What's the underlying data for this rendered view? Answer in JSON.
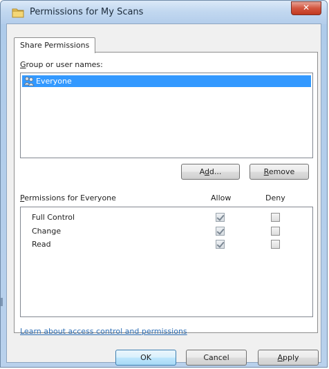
{
  "window": {
    "title": "Permissions for My Scans",
    "close_label": "✕"
  },
  "tab": {
    "label": "Share Permissions"
  },
  "groups": {
    "label_prefix": "G",
    "label_rest": "roup or user names:",
    "items": [
      {
        "name": "Everyone",
        "selected": true
      }
    ]
  },
  "buttons": {
    "add_pre": "A",
    "add_u": "d",
    "add_post": "d...",
    "remove_u": "R",
    "remove_rest": "emove",
    "ok": "OK",
    "cancel": "Cancel",
    "apply_u": "A",
    "apply_rest": "pply"
  },
  "permissions": {
    "label_u": "P",
    "label_rest": "ermissions for Everyone",
    "allow_header": "Allow",
    "deny_header": "Deny",
    "rows": [
      {
        "name": "Full Control",
        "allow": true,
        "deny": false
      },
      {
        "name": "Change",
        "allow": true,
        "deny": false
      },
      {
        "name": "Read",
        "allow": true,
        "deny": false
      }
    ]
  },
  "help_link": "Learn about access control and permissions",
  "colors": {
    "selection": "#3399ff",
    "link": "#2f6fb5",
    "close": "#c1391f"
  },
  "icons": {
    "title": "shared-folder-icon",
    "user": "users-group-icon"
  }
}
